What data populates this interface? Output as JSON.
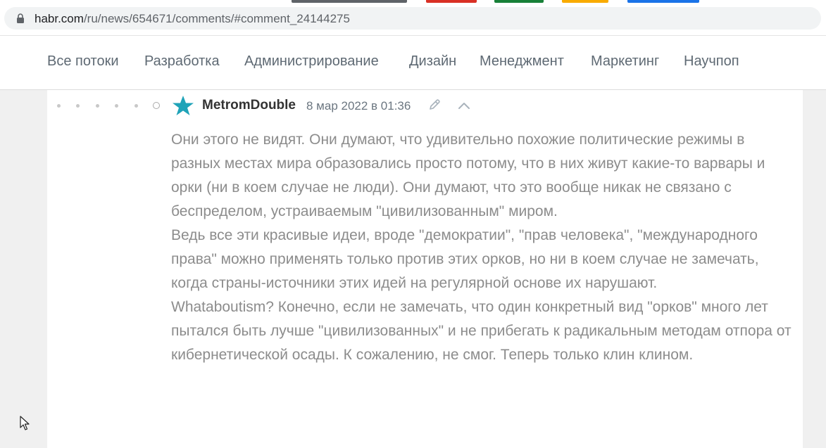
{
  "browser": {
    "url_host": "habr.com",
    "url_path": "/ru/news/654671/comments/#comment_24144275",
    "lock_icon": "lock-icon",
    "tab_colors": [
      "#5f6368",
      "#d93025",
      "#188038",
      "#f9ab00",
      "#1a73e8"
    ]
  },
  "nav": {
    "items": [
      {
        "label": "Все потоки"
      },
      {
        "label": "Разработка"
      },
      {
        "label": "Администрирование"
      },
      {
        "label": "Дизайн"
      },
      {
        "label": "Менеджмент"
      },
      {
        "label": "Маркетинг"
      },
      {
        "label": "Научпоп"
      }
    ]
  },
  "comment": {
    "author": "MetromDouble",
    "timestamp": "8 мар 2022 в 01:36",
    "avatar_icon": "star-icon",
    "accent_color": "#1fa3b8",
    "paragraphs": [
      "Они этого не видят. Они думают, что удивительно похожие политические режимы в разных местах мира образовались просто потому, что в них живут какие-то варвары и орки (ни в коем случае не люди). Они думают, что это вообще никак не связано с беспределом, устраиваемым \"цивилизованным\" миром.",
      "Ведь все эти красивые идеи, вроде \"демократии\", \"прав человека\", \"международного права\" можно применять только против этих орков, но ни в коем случае не замечать, когда страны-источники этих идей на регулярной основе их нарушают.",
      "Whataboutism? Конечно, если не замечать, что один конкретный вид \"орков\" много лет пытался быть лучше \"цивилизованных\" и не прибегать к радикальным методам отпора от кибернетической осады. К сожалению, не смог. Теперь только клин клином."
    ]
  }
}
